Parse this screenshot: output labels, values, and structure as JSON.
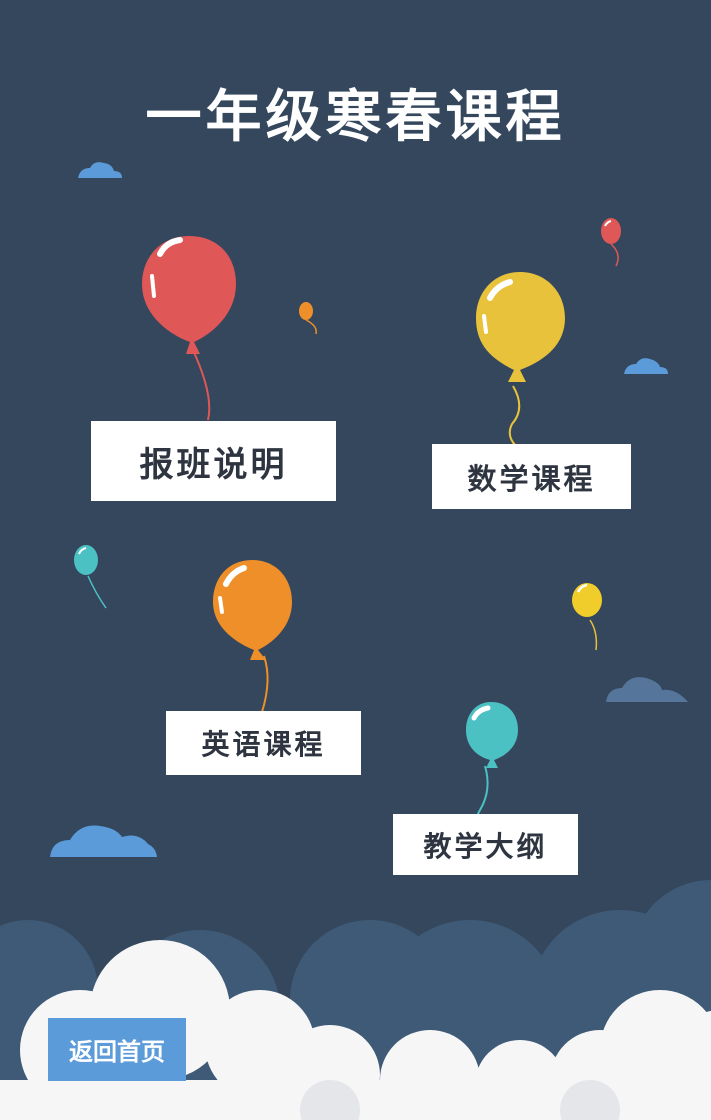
{
  "title": "一年级寒春课程",
  "menu": {
    "registration_info": "报班说明",
    "math_course": "数学课程",
    "english_course": "英语课程",
    "syllabus": "教学大纲"
  },
  "back_home": "返回首页",
  "colors": {
    "background": "#34475d",
    "card": "#ffffff",
    "card_text": "#2e3540",
    "back_button": "#5b9bd9",
    "balloon_red": "#df5757",
    "balloon_yellow": "#e8c23a",
    "balloon_orange": "#ee8f2a",
    "balloon_teal": "#4cc1c4",
    "cloud_blue": "#5b9bd9",
    "cloud_white": "#f6f6f7"
  }
}
